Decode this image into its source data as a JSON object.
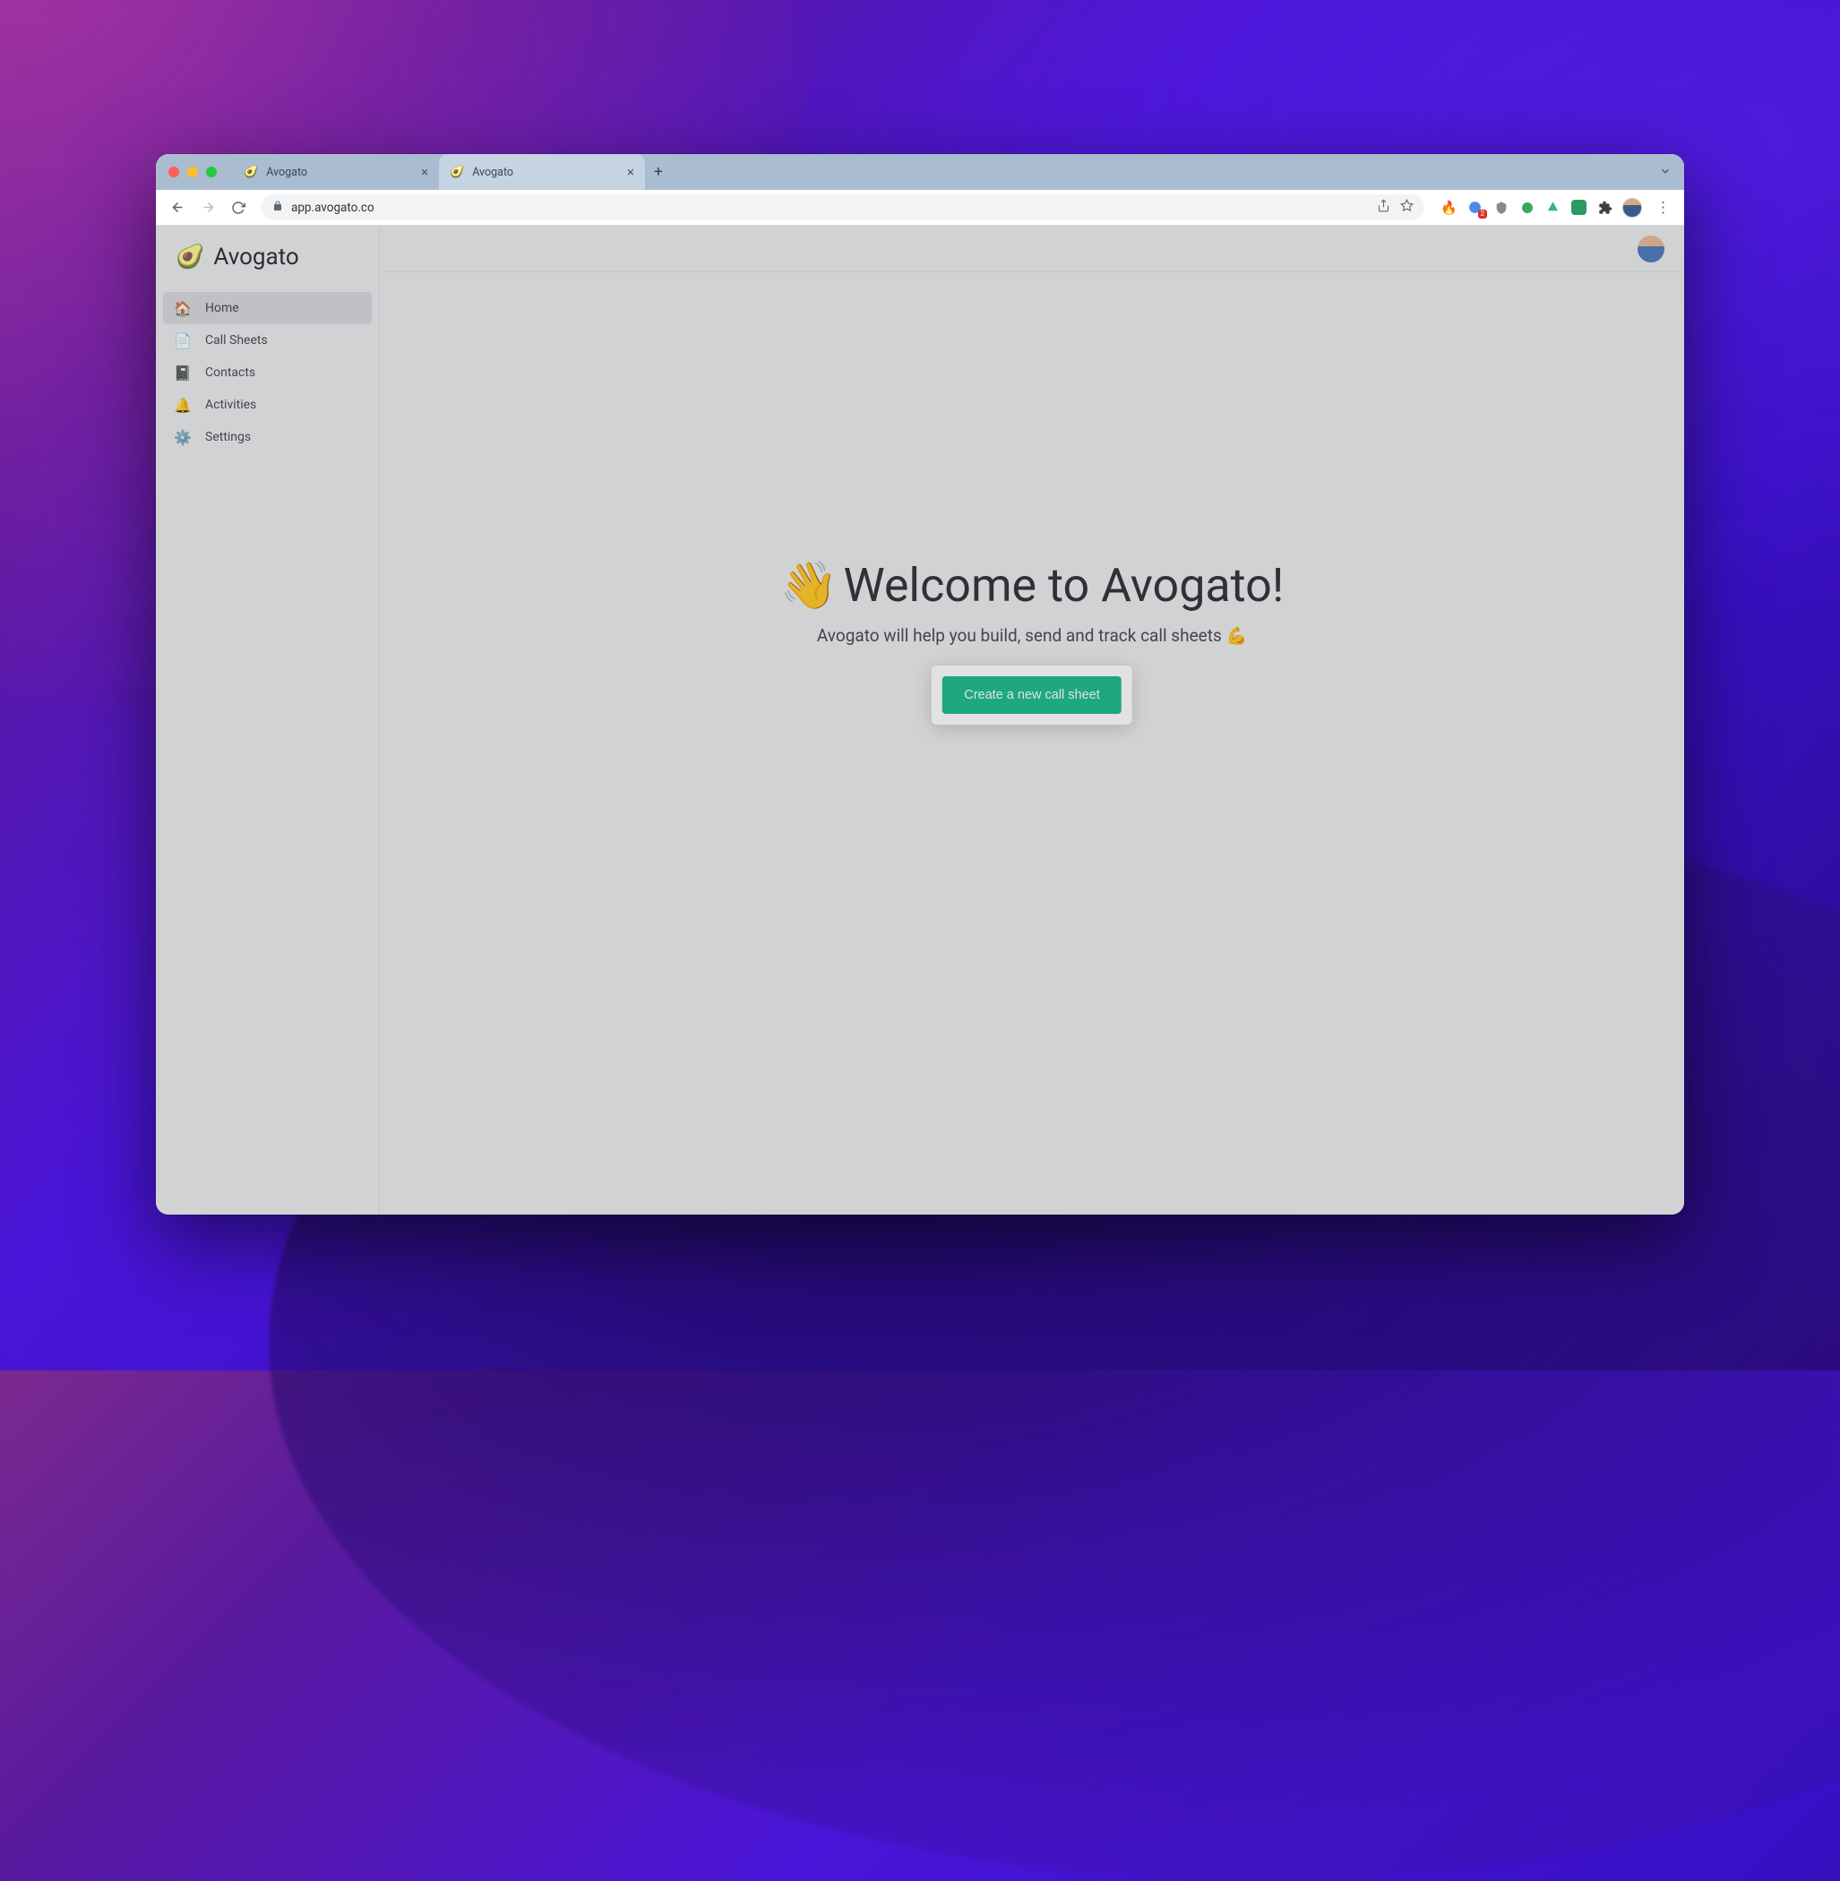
{
  "browser": {
    "tabs": [
      {
        "title": "Avogato",
        "active": false
      },
      {
        "title": "Avogato",
        "active": true
      }
    ],
    "url": "app.avogato.co",
    "extension_badge": "2"
  },
  "app": {
    "brand": "Avogato",
    "brand_icon": "🥑",
    "nav": [
      {
        "label": "Home",
        "icon": "🏠",
        "active": true
      },
      {
        "label": "Call Sheets",
        "icon": "📄",
        "active": false
      },
      {
        "label": "Contacts",
        "icon": "📓",
        "active": false
      },
      {
        "label": "Activities",
        "icon": "🔔",
        "active": false
      },
      {
        "label": "Settings",
        "icon": "⚙️",
        "active": false
      }
    ],
    "hero": {
      "wave_emoji": "👋",
      "title": "Welcome to Avogato!",
      "subtitle": "Avogato will help you build, send and track call sheets 💪",
      "cta_label": "Create a new call sheet"
    }
  }
}
